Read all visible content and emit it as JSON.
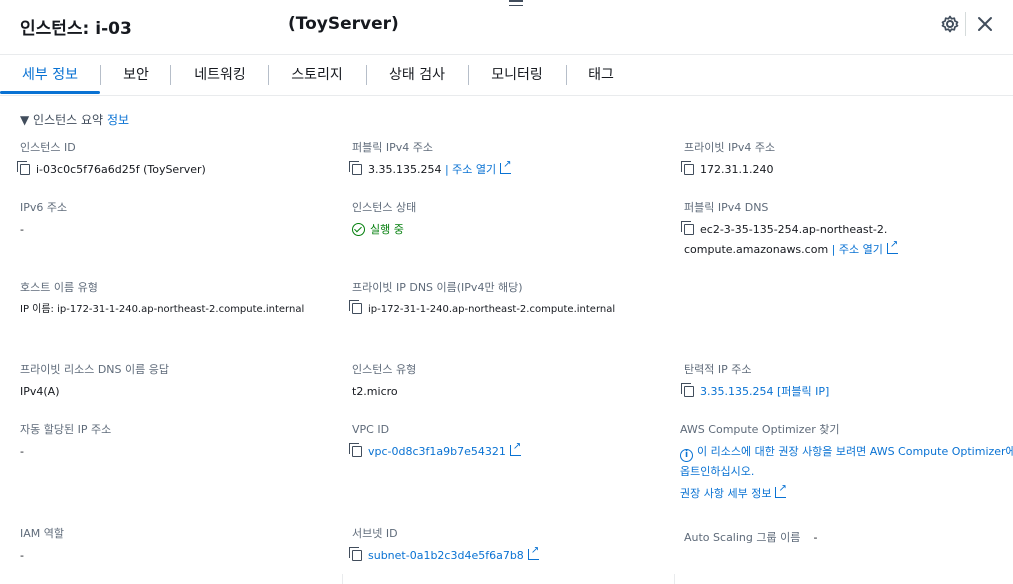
{
  "header": {
    "title": "인스턴스: i-03",
    "server_name": "(ToyServer)"
  },
  "tabs": [
    {
      "label": "세부 정보"
    },
    {
      "label": "보안"
    },
    {
      "label": "네트워킹"
    },
    {
      "label": "스토리지"
    },
    {
      "label": "상태 검사"
    },
    {
      "label": "모니터링"
    },
    {
      "label": "태그"
    }
  ],
  "summary": {
    "title": "▼ 인스턴스 요약",
    "info_link": "정보"
  },
  "fields": {
    "instance_id": {
      "label": "인스턴스 ID",
      "value": "i-03c0c5f76a6d25f (ToyServer)"
    },
    "public_ipv4": {
      "label": "퍼블릭 IPv4 주소",
      "value": "3.35.135.254",
      "link": "| 주소 열기"
    },
    "private_ipv4": {
      "label": "프라이빗 IPv4 주소",
      "value": "172.31.1.240"
    },
    "ipv6": {
      "label": "IPv6 주소",
      "value": "-"
    },
    "instance_state": {
      "label": "인스턴스 상태",
      "value": "실행 중"
    },
    "public_dns": {
      "label": "퍼블릭 IPv4 DNS",
      "value": "ec2-3-35-135-254.ap-northeast-2.",
      "value2": "compute.amazonaws.com",
      "link": "| 주소 열기"
    },
    "hostname_type": {
      "label": "호스트 이름 유형",
      "value": "IP 이름: ip-172-31-1-240.ap-northeast-2.compute.internal"
    },
    "private_dns_name": {
      "label": "프라이빗 IP DNS 이름(IPv4만 해당)",
      "value": "ip-172-31-1-240.ap-northeast-2.compute.internal"
    },
    "answer_private_dns": {
      "label": "프라이빗 리소스 DNS 이름 응답",
      "value": "IPv4(A)"
    },
    "instance_type": {
      "label": "인스턴스 유형",
      "value": "t2.micro"
    },
    "elastic_ip": {
      "label": "탄력적 IP 주소",
      "value": "3.35.135.254 [퍼블릭 IP]"
    },
    "auto_ip": {
      "label": "자동 할당된 IP 주소",
      "value": "-"
    },
    "vpc_id": {
      "label": "VPC ID",
      "value": "vpc-0d8c3f1a9b7e54321"
    },
    "optimizer": {
      "label": "AWS Compute Optimizer 찾기",
      "value": "이 리소스에 대한 권장 사항을 보려면 AWS Compute Optimizer에",
      "value2": "옵트인하십시오.",
      "link": "권장 사항 세부 정보"
    },
    "iam_role": {
      "label": "IAM 역할",
      "value": "-"
    },
    "subnet_id": {
      "label": "서브넷 ID",
      "value": "subnet-0a1b2c3d4e5f6a7b8"
    },
    "auto_scaling": {
      "label": "Auto Scaling 그룹 이름",
      "value": "-"
    }
  },
  "colors": {
    "accent": "#0972d3",
    "success": "#037f0c",
    "text": "#16191f",
    "muted": "#5f6b7a"
  }
}
